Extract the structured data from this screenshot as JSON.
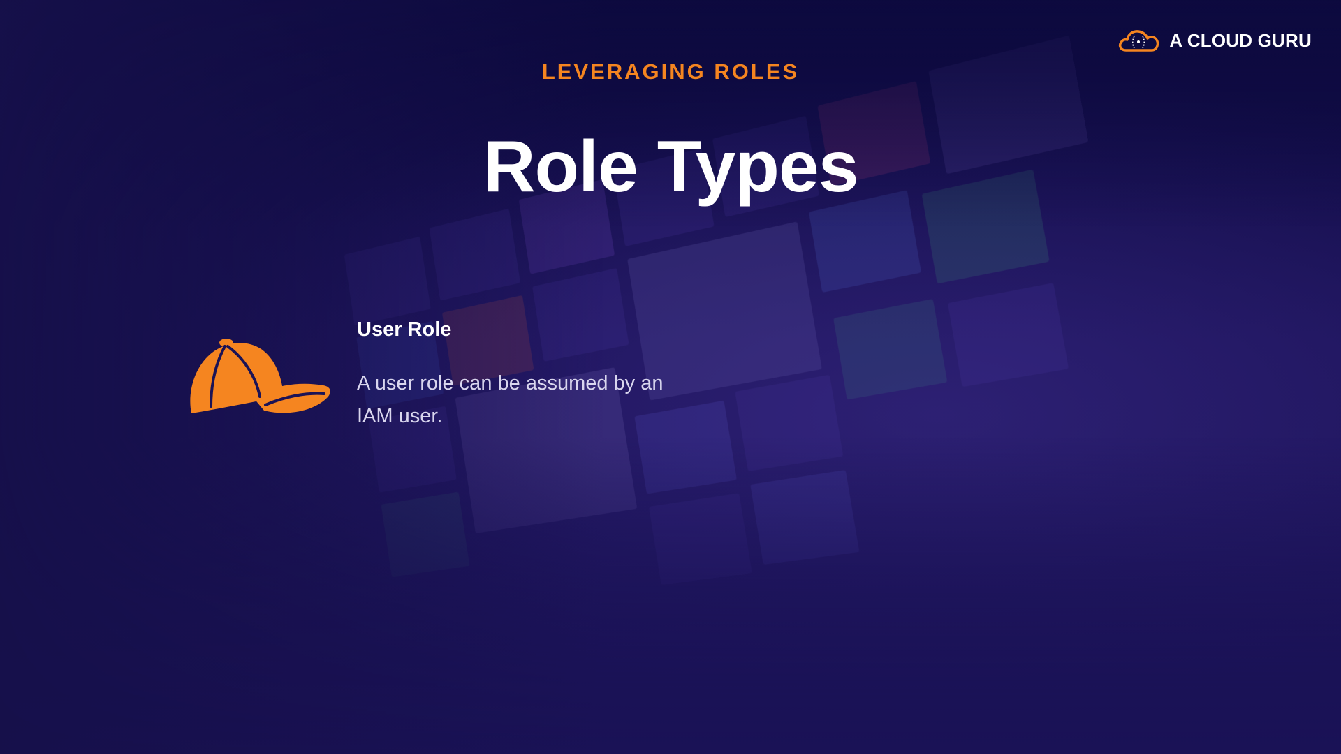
{
  "brand": {
    "name": "A CLOUD GURU",
    "logo_icon": "cloud-logo-icon",
    "accent_color": "#f58520"
  },
  "slide": {
    "kicker": "LEVERAGING ROLES",
    "title": "Role Types"
  },
  "role": {
    "icon": "cap-icon",
    "heading": "User Role",
    "description": "A user role can be assumed by an IAM user."
  },
  "colors": {
    "background": "#16104a",
    "accent": "#f58520",
    "text": "#ffffff"
  }
}
